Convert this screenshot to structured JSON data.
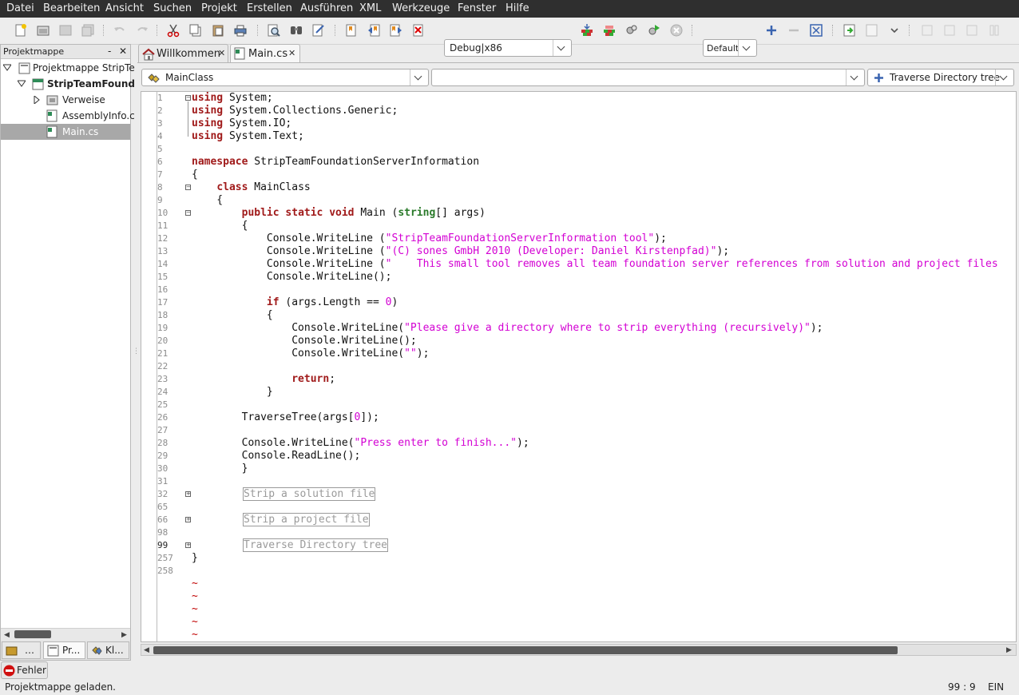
{
  "menu": [
    "Datei",
    "Bearbeiten",
    "Ansicht",
    "Suchen",
    "Projekt",
    "Erstellen",
    "Ausführen",
    "XML",
    "Werkzeuge",
    "Fenster",
    "Hilfe"
  ],
  "toolbar": {
    "config_value": "Debug|x86",
    "layout_value": "Default",
    "icons": [
      "new-file-icon",
      "open-file-icon",
      "save-icon",
      "save-all-icon",
      "undo-icon",
      "redo-icon",
      "cut-icon",
      "copy-icon",
      "paste-icon",
      "print-icon",
      "find-icon",
      "find-in-files-icon",
      "replace-icon",
      "bookmark-toggle-icon",
      "bookmark-prev-icon",
      "bookmark-next-icon",
      "bookmark-clear-icon",
      "build-icon",
      "rebuild-icon",
      "run-icon",
      "debug-run-icon",
      "stop-icon",
      "zoom-in-icon",
      "zoom-out-icon",
      "fullscreen-icon",
      "step-over-icon",
      "step-into-icon",
      "dropdown-icon"
    ]
  },
  "pad": {
    "title": "Projektmappe",
    "minimize_label": "-",
    "close_label": "✕",
    "tree": [
      {
        "label": "Projektmappe StripTe",
        "bold": false
      },
      {
        "label": "StripTeamFound",
        "bold": true
      },
      {
        "label": "Verweise",
        "bold": false
      },
      {
        "label": "AssemblyInfo.c",
        "bold": false
      },
      {
        "label": "Main.cs",
        "bold": false
      }
    ],
    "tabs": [
      "…",
      "Pr...",
      "Kl..."
    ]
  },
  "tabs": [
    {
      "label": "Willkommen",
      "close": "✕"
    },
    {
      "label": "Main.cs",
      "close": "✕"
    }
  ],
  "nav": {
    "class_combo": "MainClass",
    "member_combo": "",
    "region_combo": "Traverse Directory tree"
  },
  "line_numbers": [
    "1",
    "2",
    "3",
    "4",
    "5",
    "6",
    "7",
    "8",
    "9",
    "10",
    "11",
    "12",
    "13",
    "14",
    "15",
    "16",
    "17",
    "18",
    "19",
    "20",
    "21",
    "22",
    "23",
    "24",
    "25",
    "26",
    "27",
    "28",
    "29",
    "30",
    "31",
    "32",
    "65",
    "66",
    "98",
    "99",
    "257",
    "258"
  ],
  "code": {
    "l1_kw": "using",
    "l1_rest": " System;",
    "l2_kw": "using",
    "l2_rest": " System.Collections.Generic;",
    "l3_kw": "using",
    "l3_rest": " System.IO;",
    "l4_kw": "using",
    "l4_rest": " System.Text;",
    "l6_kw": "namespace",
    "l6_rest": " StripTeamFoundationServerInformation",
    "l7": "{",
    "l8_indent": "    ",
    "l8_kw": "class",
    "l8_rest": " MainClass",
    "l9": "    {",
    "l10_indent": "        ",
    "l10_kw": "public static void",
    "l10_mid": " Main (",
    "l10_ty": "string",
    "l10_rest": "[] args)",
    "l11": "        {",
    "l12_pre": "            Console.WriteLine (",
    "l12_str": "\"StripTeamFoundationServerInformation tool\"",
    "l12_post": ");",
    "l13_pre": "            Console.WriteLine (",
    "l13_str": "\"(C) sones GmbH 2010 (Developer: Daniel Kirstenpfad)\"",
    "l13_post": ");",
    "l14_pre": "            Console.WriteLine (",
    "l14_str": "\"    This small tool removes all team foundation server references from solution and project files",
    "l15": "            Console.WriteLine();",
    "l17_indent": "            ",
    "l17_kw": "if",
    "l17_mid": " (args.Length == ",
    "l17_num": "0",
    "l17_post": ")",
    "l18": "            {",
    "l19_pre": "                Console.WriteLine(",
    "l19_str": "\"Please give a directory where to strip everything (recursively)\"",
    "l19_post": ");",
    "l20": "                Console.WriteLine();",
    "l21_pre": "                Console.WriteLine(",
    "l21_str": "\"\"",
    "l21_post": ");",
    "l23_indent": "                ",
    "l23_kw": "return",
    "l23_post": ";",
    "l24": "            }",
    "l26_pre": "        TraverseTree(args[",
    "l26_num": "0",
    "l26_post": "]);",
    "l28_pre": "        Console.WriteLine(",
    "l28_str": "\"Press enter to finish...\"",
    "l28_post": ");",
    "l29": "        Console.ReadLine();",
    "l30": "        }",
    "fold1": "Strip a solution file",
    "fold2": "Strip a project file",
    "fold3": "Traverse Directory tree",
    "l257": "}",
    "tilde": "~"
  },
  "error_button": "Fehler",
  "status": {
    "message": "Projektmappe geladen.",
    "position": "99 : 9",
    "mode": "EIN"
  }
}
